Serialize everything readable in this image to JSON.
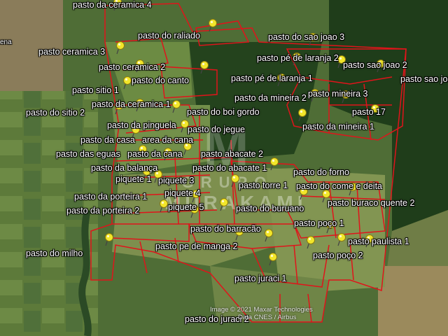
{
  "colors": {
    "boundary": "#e0141b",
    "pin_fill": "#f2e62a",
    "pin_stroke": "#8a7a10",
    "label_text": "#ffffff"
  },
  "labels": [
    "pasto da ceramica 4",
    "pasto do raliado",
    "pasto do sao joao 3",
    "pasto ceramica 3",
    "pasto pé de laranja 2",
    "pasto sao joao 2",
    "pasto ceramica 2",
    "pasto do canto",
    "pasto pé de laranja 1",
    "pasto sao joao",
    "pasto sitio 1",
    "pasto da mineira 2",
    "pasto mineira 3",
    "pasto da ceramica 1",
    "pasto do sitio 2",
    "pasto do boi gordo",
    "pasto 17",
    "pasto da pinguela",
    "pasto do jegue",
    "pasto da mineira 1",
    "pasto da casa",
    "area da cana",
    "pasto das eguas",
    "pasto da cana",
    "pasto abacate 2",
    "pasto da balança",
    "pasto do abacate 1",
    "pasto do forno",
    "piquete 1",
    "piquete 3",
    "pasto torre 1",
    "pasto do come e deita",
    "pasto da porteira 1",
    "piquete 4",
    "pasto buraco quente 2",
    "pasto da porteira 2",
    "piquete 5",
    "pasto do buruano",
    "pasto poço 1",
    "pasto do barracão",
    "pasto do milho",
    "pasto pe de manga 2",
    "pasto paulista 1",
    "pasto poço 2",
    "pasto juraci 1",
    "pasto do juraci 2",
    "ena"
  ],
  "watermark": {
    "line1": "GRUPO",
    "line2": "MURAKAMI"
  },
  "imagery_credit": {
    "line1": "Image © 2021 Maxar Technologies",
    "line2": "Data CNES / Airbus"
  }
}
